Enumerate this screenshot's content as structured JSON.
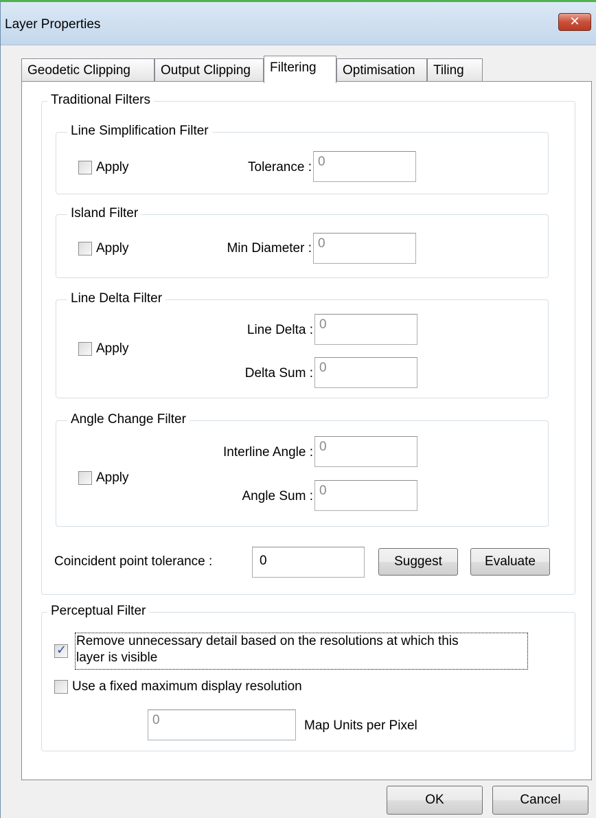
{
  "window": {
    "title": "Layer Properties",
    "close_glyph": "✕"
  },
  "tabs": [
    {
      "label": "Geodetic Clipping"
    },
    {
      "label": "Output Clipping"
    },
    {
      "label": "Filtering"
    },
    {
      "label": "Optimisation"
    },
    {
      "label": "Tiling"
    }
  ],
  "active_tab": "Filtering",
  "traditional": {
    "legend": "Traditional Filters",
    "line_simplification": {
      "legend": "Line Simplification Filter",
      "apply_label": "Apply",
      "apply_checked": false,
      "tolerance_label": "Tolerance :",
      "tolerance_value": "0"
    },
    "island": {
      "legend": "Island Filter",
      "apply_label": "Apply",
      "apply_checked": false,
      "min_diameter_label": "Min Diameter :",
      "min_diameter_value": "0"
    },
    "line_delta": {
      "legend": "Line Delta Filter",
      "apply_label": "Apply",
      "apply_checked": false,
      "line_delta_label": "Line Delta :",
      "line_delta_value": "0",
      "delta_sum_label": "Delta Sum :",
      "delta_sum_value": "0"
    },
    "angle_change": {
      "legend": "Angle Change Filter",
      "apply_label": "Apply",
      "apply_checked": false,
      "interline_angle_label": "Interline Angle :",
      "interline_angle_value": "0",
      "angle_sum_label": "Angle Sum :",
      "angle_sum_value": "0"
    },
    "coincident": {
      "label": "Coincident point tolerance :",
      "value": "0",
      "suggest_label": "Suggest",
      "evaluate_label": "Evaluate"
    }
  },
  "perceptual": {
    "legend": "Perceptual Filter",
    "remove_detail_label_line1": "Remove unnecessary detail based on the resolutions at which this",
    "remove_detail_label_line2": "layer is visible",
    "remove_detail_checked": true,
    "fixed_resolution_label": "Use a fixed maximum display resolution",
    "fixed_resolution_checked": false,
    "resolution_value": "0",
    "units_label": "Map Units per Pixel"
  },
  "footer": {
    "ok_label": "OK",
    "cancel_label": "Cancel"
  },
  "colors": {
    "window_accent": "#4fb24f",
    "close_button": "#c9503a",
    "check_mark": "#2a4ea8"
  }
}
